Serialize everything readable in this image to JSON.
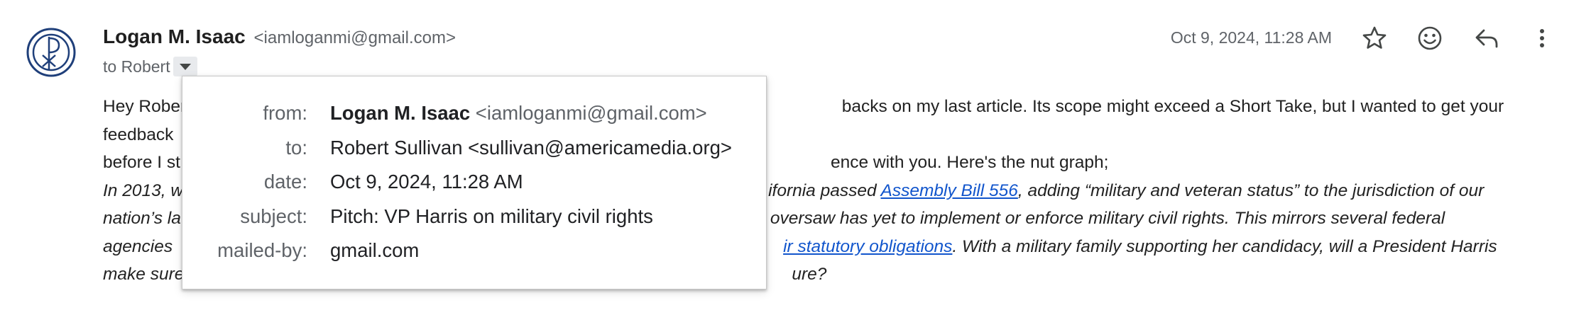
{
  "sender": {
    "name": "Logan M. Isaac",
    "email": "<iamloganmi@gmail.com>"
  },
  "recipient_line": "to Robert",
  "date": "Oct 9, 2024, 11:28 AM",
  "icons": {
    "avatar": "chi-rho-logo-avatar",
    "star": "star-icon",
    "emoji": "emoji-icon",
    "reply": "reply-icon",
    "more": "more-vert-icon",
    "dropdown": "caret-down-icon"
  },
  "body": {
    "line1_start": "Hey Robert,",
    "line1_end": "backs on my last article. Its scope might exceed a Short Take, but I wanted to get your feedback",
    "line2_start": "before I st",
    "line2_end": "ence with you. Here's the nut graph;",
    "line3_start": "In 2013, w",
    "line3_mid": "ifornia passed ",
    "line3_link": "Assembly Bill 556",
    "line3_end": ", adding “military and veteran status” to the jurisdiction of our",
    "line4_start": "nation’s la",
    "line4_end": "oversaw has yet to implement or enforce military civil rights. This mirrors several federal",
    "line5_start": "agencies",
    "line5_link": "ir statutory obligations",
    "line5_end": ". With a military family supporting her candidacy, will a President Harris",
    "line6_start": "make sure",
    "line6_end": "ure?"
  },
  "details_popup": {
    "rows": [
      {
        "label": "from:",
        "name": "Logan M. Isaac",
        "email": "<iamloganmi@gmail.com>"
      },
      {
        "label": "to:",
        "value": "Robert Sullivan <sullivan@americamedia.org>"
      },
      {
        "label": "date:",
        "value": "Oct 9, 2024, 11:28 AM"
      },
      {
        "label": "subject:",
        "value": "Pitch: VP Harris on military civil rights"
      },
      {
        "label": "mailed-by:",
        "value": "gmail.com"
      }
    ]
  },
  "colors": {
    "link": "#1155cc",
    "avatar_blue": "#1f3f7a",
    "icon_grey": "#444746"
  }
}
